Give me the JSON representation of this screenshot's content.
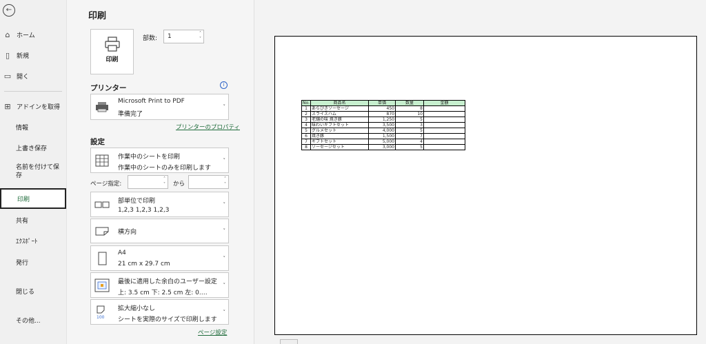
{
  "sidebar": {
    "items": [
      {
        "label": "ホーム",
        "icon": "home-icon",
        "glyph": "⌂"
      },
      {
        "label": "新規",
        "icon": "new-file-icon",
        "glyph": "🗋"
      },
      {
        "label": "開く",
        "icon": "folder-icon",
        "glyph": "🗁"
      },
      {
        "label": "アドインを取得",
        "icon": "grid-icon",
        "glyph": "⊞"
      },
      {
        "label": "情報"
      },
      {
        "label": "上書き保存"
      },
      {
        "label": "名前を付けて保存"
      },
      {
        "label": "印刷"
      },
      {
        "label": "共有"
      },
      {
        "label": "ｴｸｽﾎﾟｰﾄ"
      },
      {
        "label": "発行"
      },
      {
        "label": "閉じる"
      },
      {
        "label": "その他..."
      }
    ]
  },
  "panel": {
    "title": "印刷",
    "print_button": "印刷",
    "copies_label": "部数:",
    "copies_value": "1",
    "printer_section": "プリンター",
    "printer_name": "Microsoft Print to PDF",
    "printer_status": "準備完了",
    "printer_props_link": "プリンターのプロパティ",
    "settings_section": "設定",
    "settings": {
      "scope_title": "作業中のシートを印刷",
      "scope_sub": "作業中のシートのみを印刷します",
      "pages_label": "ページ指定:",
      "pages_to": "から",
      "collate_title": "部単位で印刷",
      "collate_sub": "1,2,3    1,2,3    1,2,3",
      "orientation": "横方向",
      "paper_title": "A4",
      "paper_sub": "21 cm x 29.7 cm",
      "margins_title": "最後に適用した余白のユーザー設定",
      "margins_sub": "上: 3.5 cm 下: 2.5 cm 左: 0.…",
      "scaling_title": "拡大縮小なし",
      "scaling_sub": "シートを実際のサイズで印刷します"
    },
    "page_setup_link": "ページ設定"
  },
  "preview": {
    "headers": [
      "No.",
      "商品名",
      "単価",
      "数量",
      "金額"
    ],
    "rows": [
      [
        "1",
        "あらびきソーセージ",
        "450",
        "8",
        ""
      ],
      [
        "2",
        "スライスハム",
        "870",
        "10",
        ""
      ],
      [
        "3",
        "老舗の味 焼き豚",
        "1,250",
        "5",
        ""
      ],
      [
        "4",
        "味わいギフトセット",
        "3,500",
        "3",
        ""
      ],
      [
        "5",
        "グルメセット",
        "4,000",
        "5",
        ""
      ],
      [
        "6",
        "焼き豚",
        "1,500",
        "7",
        ""
      ],
      [
        "7",
        "ギフトセット",
        "5,000",
        "4",
        ""
      ],
      [
        "8",
        "ソーセージセット",
        "3,000",
        "5",
        ""
      ]
    ]
  }
}
